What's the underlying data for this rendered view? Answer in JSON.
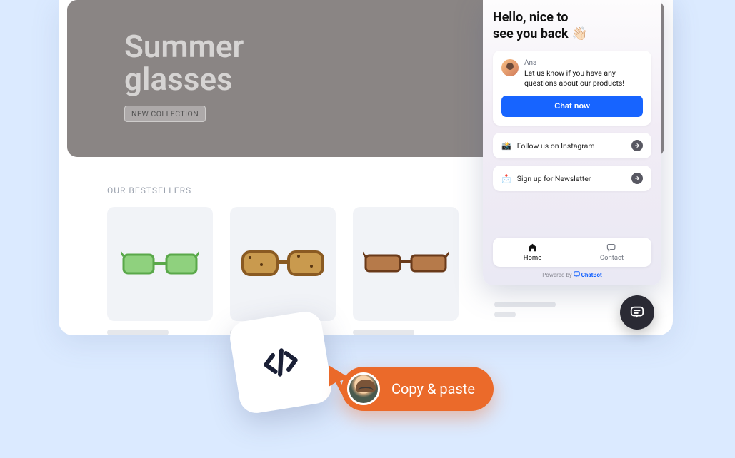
{
  "hero": {
    "title_line1": "Summer",
    "title_line2": "glasses",
    "badge": "NEW COLLECTION"
  },
  "bestsellers": {
    "title": "OUR BESTSELLERS"
  },
  "chat": {
    "greeting_line1": "Hello, nice to",
    "greeting_line2": "see you back",
    "wave_emoji": "👋🏻",
    "agent_name": "Ana",
    "agent_message": "Let us know if you have any questions about our products!",
    "chat_button": "Chat now",
    "instagram_label": "Follow us on Instagram",
    "instagram_emoji": "📸",
    "newsletter_label": "Sign up for Newsletter",
    "newsletter_emoji": "📩",
    "nav_home": "Home",
    "nav_contact": "Contact",
    "powered_prefix": "Powered by",
    "powered_brand": "ChatBot"
  },
  "cta": {
    "copy_paste": "Copy & paste"
  }
}
